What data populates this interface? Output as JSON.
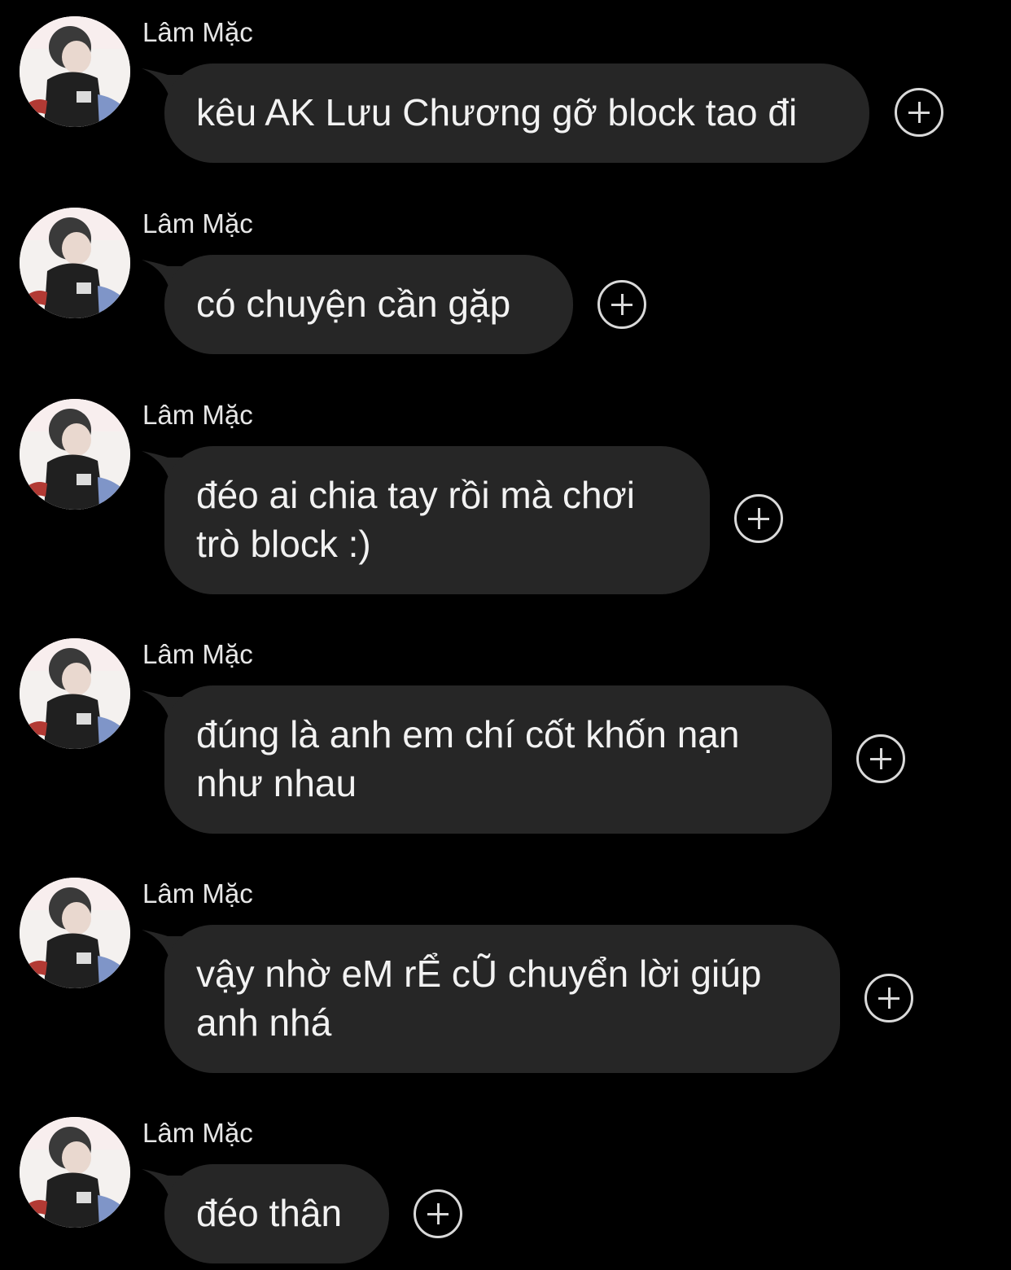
{
  "colors": {
    "background": "#000000",
    "bubble": "#262626",
    "text": "#f2f2f2",
    "sender": "#e6e6e6",
    "icon": "#d9d9d9"
  },
  "messages": [
    {
      "sender": "Lâm Mặc",
      "text": "kêu AK Lưu Chương gỡ block tao đi"
    },
    {
      "sender": "Lâm Mặc",
      "text": "có chuyện cần gặp"
    },
    {
      "sender": "Lâm Mặc",
      "text": "đéo ai chia tay rồi mà chơi trò block :)"
    },
    {
      "sender": "Lâm Mặc",
      "text": "đúng là anh em chí cốt khốn nạn như nhau"
    },
    {
      "sender": "Lâm Mặc",
      "text": "vậy nhờ eM rỂ cŨ chuyển lời giúp anh nhá"
    },
    {
      "sender": "Lâm Mặc",
      "text": "đéo thân"
    }
  ]
}
